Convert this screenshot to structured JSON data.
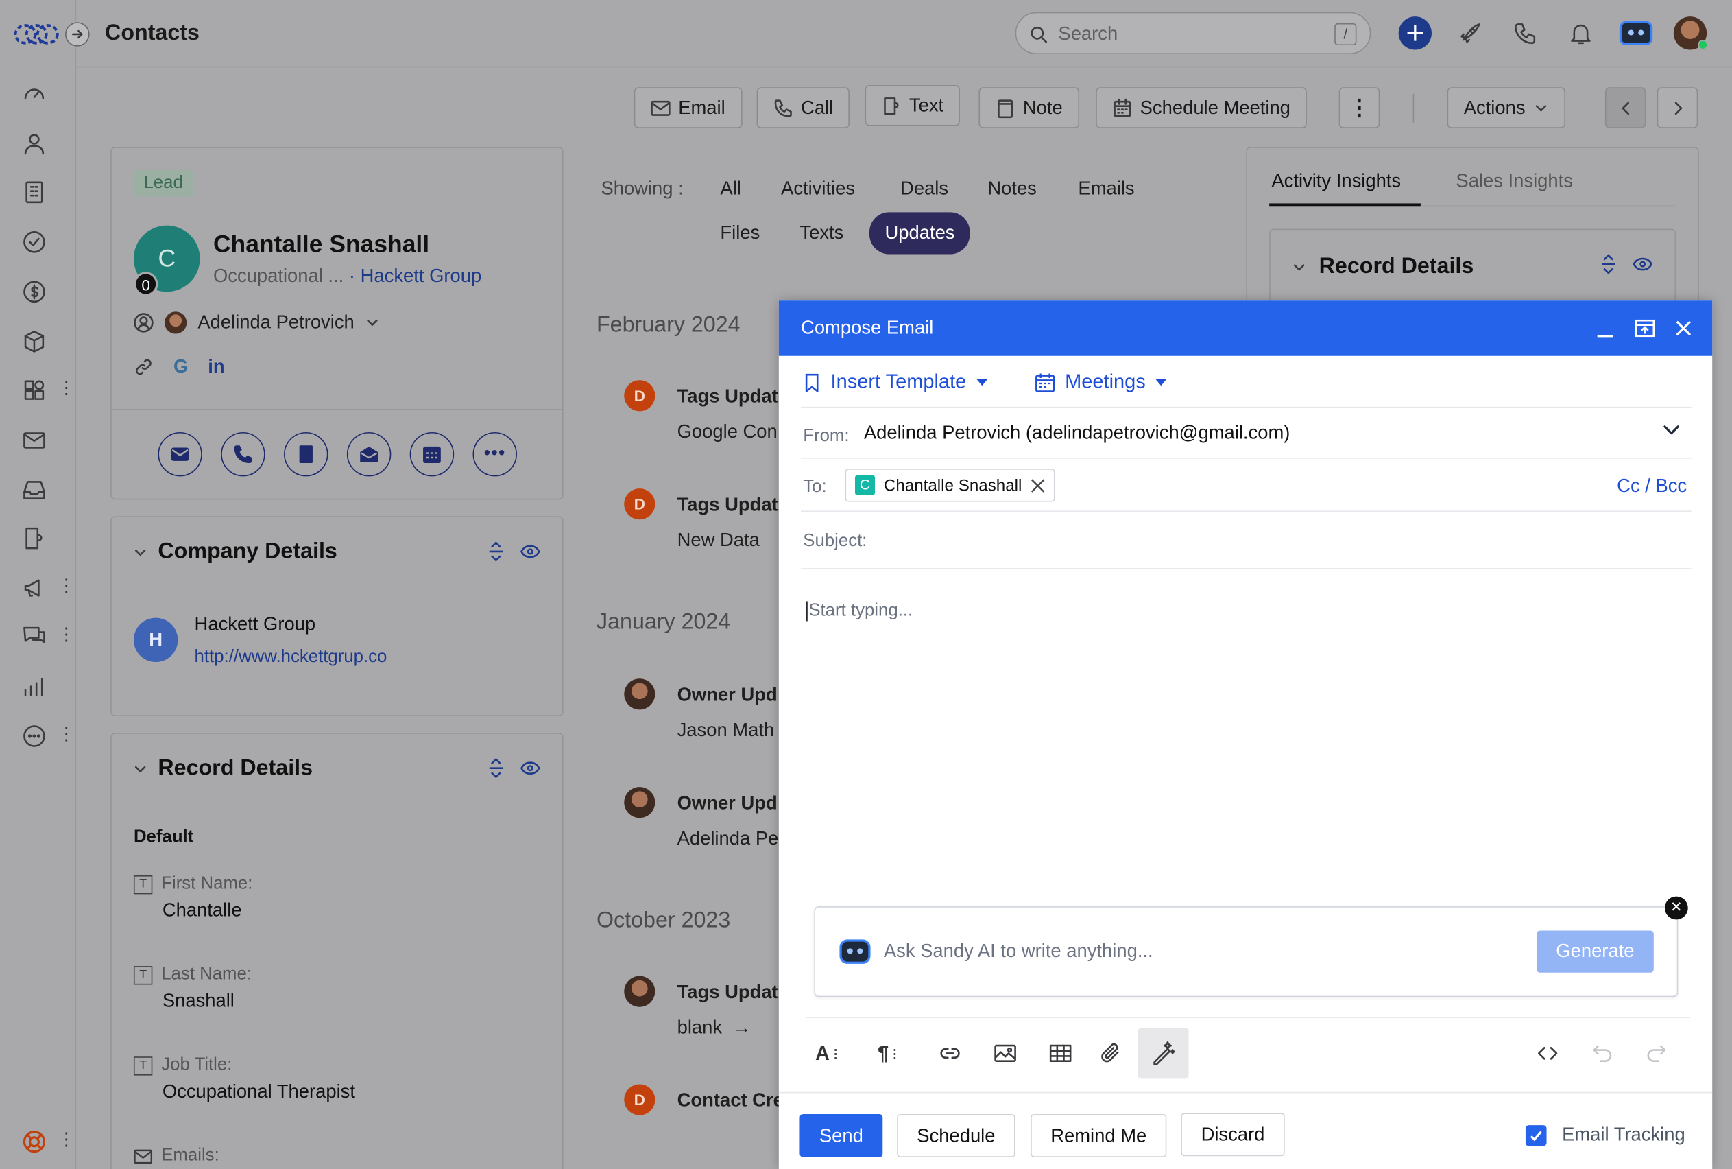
{
  "header": {
    "title": "Contacts",
    "search_placeholder": "Search",
    "search_shortcut": "/"
  },
  "actions": {
    "email": "Email",
    "call": "Call",
    "text": "Text",
    "note": "Note",
    "schedule_meeting": "Schedule Meeting",
    "actions": "Actions"
  },
  "contact": {
    "badge": "Lead",
    "initial": "C",
    "count": "0",
    "name": "Chantalle Snashall",
    "job_short": "Occupational ...",
    "company": "Hackett Group",
    "owner": "Adelinda Petrovich"
  },
  "company_section": {
    "title": "Company Details",
    "initial": "H",
    "name": "Hackett Group",
    "url": "http://www.hckettgrup.co"
  },
  "record_section": {
    "title": "Record Details",
    "group": "Default",
    "fields": [
      {
        "label": "First Name:",
        "value": "Chantalle"
      },
      {
        "label": "Last Name:",
        "value": "Snashall"
      },
      {
        "label": "Job Title:",
        "value": "Occupational Therapist"
      },
      {
        "label": "Emails:",
        "value": ""
      }
    ]
  },
  "timeline": {
    "showing_label": "Showing :",
    "filters": [
      "All",
      "Activities",
      "Deals",
      "Notes",
      "Emails",
      "Files",
      "Texts",
      "Updates"
    ],
    "active_filter": "Updates",
    "months": [
      "February 2024",
      "January 2024",
      "October 2023"
    ],
    "items": [
      {
        "avatar": "D",
        "title": "Tags Updat",
        "sub": "Google Con"
      },
      {
        "avatar": "D",
        "title": "Tags Updat",
        "sub": "New Data"
      },
      {
        "avatar": "",
        "title": "Owner Upd",
        "sub": "Jason Math"
      },
      {
        "avatar": "",
        "title": "Owner Upd",
        "sub": "Adelinda Pe"
      },
      {
        "avatar": "",
        "title": "Tags Updat",
        "sub": "blank  →"
      },
      {
        "avatar": "D",
        "title": "Contact Cre",
        "sub": ""
      }
    ]
  },
  "insights": {
    "tabs": [
      "Activity Insights",
      "Sales Insights"
    ],
    "active_tab": "Activity Insights",
    "section_title": "Record Details"
  },
  "compose": {
    "title": "Compose Email",
    "insert_template": "Insert Template",
    "meetings": "Meetings",
    "from_label": "From:",
    "from_value": "Adelinda Petrovich (adelindapetrovich@gmail.com)",
    "to_label": "To:",
    "to_chip_initial": "C",
    "to_chip_name": "Chantalle Snashall",
    "cc_bcc": "Cc / Bcc",
    "subject_label": "Subject:",
    "body_placeholder": "Start typing...",
    "ai_placeholder": "Ask Sandy AI to write anything...",
    "generate": "Generate",
    "send": "Send",
    "schedule": "Schedule",
    "remind_me": "Remind Me",
    "discard": "Discard",
    "email_tracking": "Email Tracking",
    "email_tracking_checked": true
  },
  "colors": {
    "primary": "#2563eb",
    "active_filter_bg": "#2e2a5c",
    "lead_badge": "#3c6b53",
    "avatar_teal": "#1f7f76",
    "avatar_orange": "#c2410c"
  }
}
